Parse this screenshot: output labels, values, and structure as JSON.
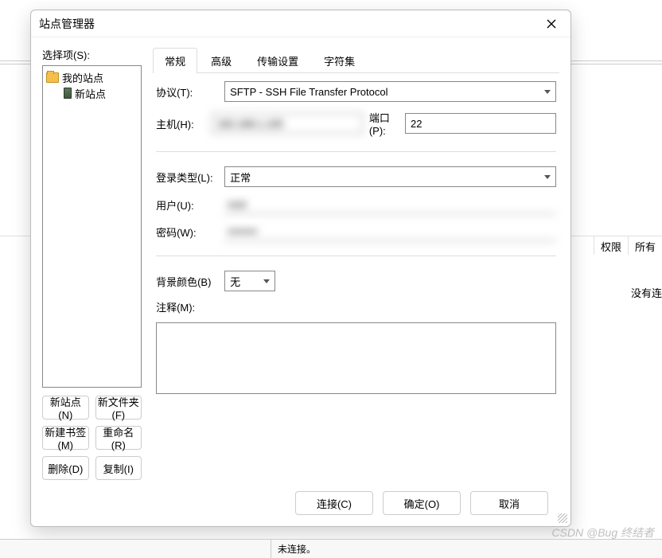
{
  "bg": {
    "col_permission": "权限",
    "col_owner": "所有",
    "no_connection": "没有连"
  },
  "dialog": {
    "title": "站点管理器",
    "select_label": "选择项(S):",
    "tree": {
      "root": "我的站点",
      "child": "新站点"
    },
    "left_buttons": {
      "new_site": "新站点(N)",
      "new_folder": "新文件夹(F)",
      "new_bookmark": "新建书签(M)",
      "rename": "重命名(R)",
      "delete": "删除(D)",
      "copy": "复制(I)"
    },
    "tabs": {
      "general": "常规",
      "advanced": "高级",
      "transfer": "传输设置",
      "charset": "字符集"
    },
    "form": {
      "protocol_label": "协议(T):",
      "protocol_value": "SFTP - SSH File Transfer Protocol",
      "host_label": "主机(H):",
      "host_value": "192.168.1.100",
      "port_label": "端口(P):",
      "port_value": "22",
      "logon_label": "登录类型(L):",
      "logon_value": "正常",
      "user_label": "用户(U):",
      "user_value": "root",
      "password_label": "密码(W):",
      "password_value": "••••••••",
      "bgcolor_label": "背景颜色(B)",
      "bgcolor_value": "无",
      "comment_label": "注释(M):",
      "comment_value": ""
    },
    "bottom_buttons": {
      "connect": "连接(C)",
      "ok": "确定(O)",
      "cancel": "取消"
    }
  },
  "status_bar": {
    "not_connected": "未连接。"
  },
  "watermark": "CSDN @Bug 终结者"
}
